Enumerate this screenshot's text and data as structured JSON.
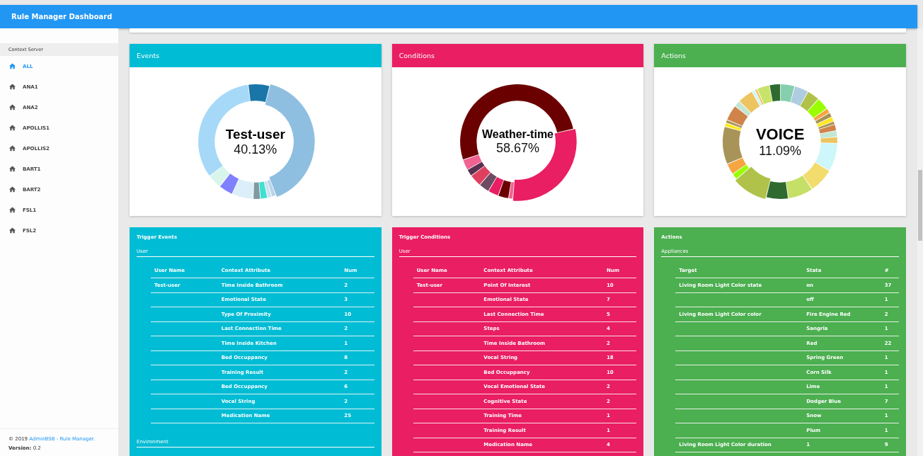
{
  "header": {
    "title": "Rule Manager Dashboard"
  },
  "sidebar": {
    "section_label": "Context Server",
    "items": [
      {
        "label": "ALL",
        "selected": true
      },
      {
        "label": "ANA1",
        "selected": false
      },
      {
        "label": "ANA2",
        "selected": false
      },
      {
        "label": "APOLLIS1",
        "selected": false
      },
      {
        "label": "APOLLIS2",
        "selected": false
      },
      {
        "label": "BART1",
        "selected": false
      },
      {
        "label": "BART2",
        "selected": false
      },
      {
        "label": "FSL1",
        "selected": false
      },
      {
        "label": "FSL2",
        "selected": false
      }
    ],
    "footer": {
      "copyright": "© 2019",
      "link": "AdminBSB - Rule Manager.",
      "version": "**Version:** 0.2"
    }
  },
  "charts": [
    {
      "kind": "events",
      "title": "Events",
      "color": "#00bcd4",
      "center_label": "Test-user",
      "center_value": "40.13%"
    },
    {
      "kind": "conditions",
      "title": "Conditions",
      "color": "#e91e63",
      "center_label": "Weather-time",
      "center_value": "58.67%"
    },
    {
      "kind": "actions",
      "title": "Actions",
      "color": "#4caf50",
      "center_label": "VOICE",
      "center_value": "11.09%"
    }
  ],
  "tables": [
    {
      "title": "Trigger Events",
      "color": "#00bcd4",
      "sections": [
        {
          "title": "User",
          "columns": [
            "User Name",
            "Context Attribute",
            "Num"
          ],
          "rows": [
            [
              "Test-user",
              "Time Inside Bathroom",
              "2"
            ],
            [
              "",
              "Emotional State",
              "3"
            ],
            [
              "",
              "Type Of Proximity",
              "10"
            ],
            [
              "",
              "Last Connection Time",
              "2"
            ],
            [
              "",
              "Time Inside Kitchen",
              "1"
            ],
            [
              "",
              "Bed Occuppancy",
              "8"
            ],
            [
              "",
              "Training Result",
              "2"
            ],
            [
              "",
              "Bed Occuppancy",
              "6"
            ],
            [
              "",
              "Vocal String",
              "2"
            ],
            [
              "",
              "Medication Name",
              "25"
            ]
          ]
        },
        {
          "title": "Environment"
        }
      ]
    },
    {
      "title": "Trigger Conditions",
      "color": "#e91e63",
      "sections": [
        {
          "title": "User",
          "columns": [
            "User Name",
            "Context Attribute",
            "Num"
          ],
          "rows": [
            [
              "Test-user",
              "Point Of Interest",
              "10"
            ],
            [
              "",
              "Emotional State",
              "7"
            ],
            [
              "",
              "Last Connection Time",
              "5"
            ],
            [
              "",
              "Steps",
              "4"
            ],
            [
              "",
              "Time Inside Bathroom",
              "2"
            ],
            [
              "",
              "Vocal String",
              "18"
            ],
            [
              "",
              "Bed Occuppancy",
              "10"
            ],
            [
              "",
              "Vocal Emotional State",
              "2"
            ],
            [
              "",
              "Cognitive State",
              "2"
            ],
            [
              "",
              "Training Time",
              "1"
            ],
            [
              "",
              "Training Result",
              "1"
            ],
            [
              "",
              "Medication Name",
              "4"
            ]
          ]
        }
      ]
    },
    {
      "title": "Actions",
      "color": "#4caf50",
      "sections": [
        {
          "title": "Appliances",
          "columns": [
            "Target",
            "State",
            "#"
          ],
          "rows": [
            [
              "Living Room Light Color state",
              "on",
              "37"
            ],
            [
              "",
              "off",
              "1"
            ],
            [
              "Living Room Light Color color",
              "Fire Engine Red",
              "2"
            ],
            [
              "",
              "Sangria",
              "1"
            ],
            [
              "",
              "Red",
              "22"
            ],
            [
              "",
              "Spring Green",
              "1"
            ],
            [
              "",
              "Corn Silk",
              "1"
            ],
            [
              "",
              "Lime",
              "1"
            ],
            [
              "",
              "Dodger Blue",
              "7"
            ],
            [
              "",
              "Snow",
              "1"
            ],
            [
              "",
              "Plum",
              "1"
            ],
            [
              "Living Room Light Color duration",
              "1",
              "9"
            ]
          ]
        }
      ]
    }
  ]
}
